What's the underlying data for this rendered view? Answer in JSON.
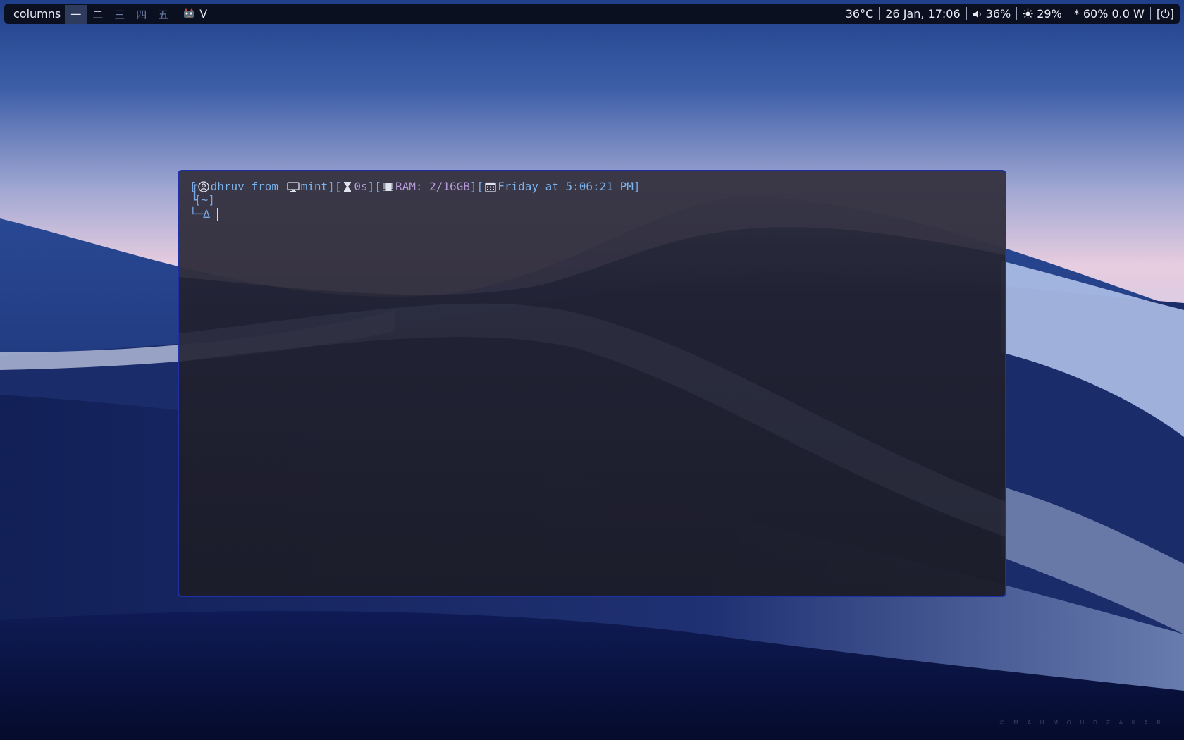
{
  "bar": {
    "layout": "columns",
    "workspaces": [
      {
        "label": "一",
        "state": "active"
      },
      {
        "label": "二",
        "state": "occupied"
      },
      {
        "label": "三",
        "state": "empty"
      },
      {
        "label": "四",
        "state": "empty"
      },
      {
        "label": "五",
        "state": "empty"
      }
    ],
    "focused_app": "V",
    "focused_app_icon": "vim-app-icon",
    "temperature": "36°C",
    "datetime": "26 Jan, 17:06",
    "volume_icon": "speaker-icon",
    "volume": "36%",
    "brightness_icon": "sun-icon",
    "brightness": "29%",
    "battery": "* 60% 0.0 W",
    "power_icon": "power-icon",
    "power_label": "[⏻]"
  },
  "terminal": {
    "user": "dhruv",
    "from_word": "from",
    "host": "mint",
    "duration": "0s",
    "ram": "RAM: 2/16GB",
    "date": "Friday at 5:06:21 PM",
    "cwd": "~",
    "prompt_symbol": "└─∆",
    "icons": [
      "user-circle-icon",
      "monitor-icon",
      "hourglass-icon",
      "memory-chip-icon",
      "calendar-icon"
    ],
    "colors": {
      "bracket": "#7aa8e6",
      "user": "#7cb4ee",
      "muted": "#b39ad8",
      "border": "#1f2fa8"
    }
  },
  "watermark": "© M A H M O U D Z A K A R"
}
